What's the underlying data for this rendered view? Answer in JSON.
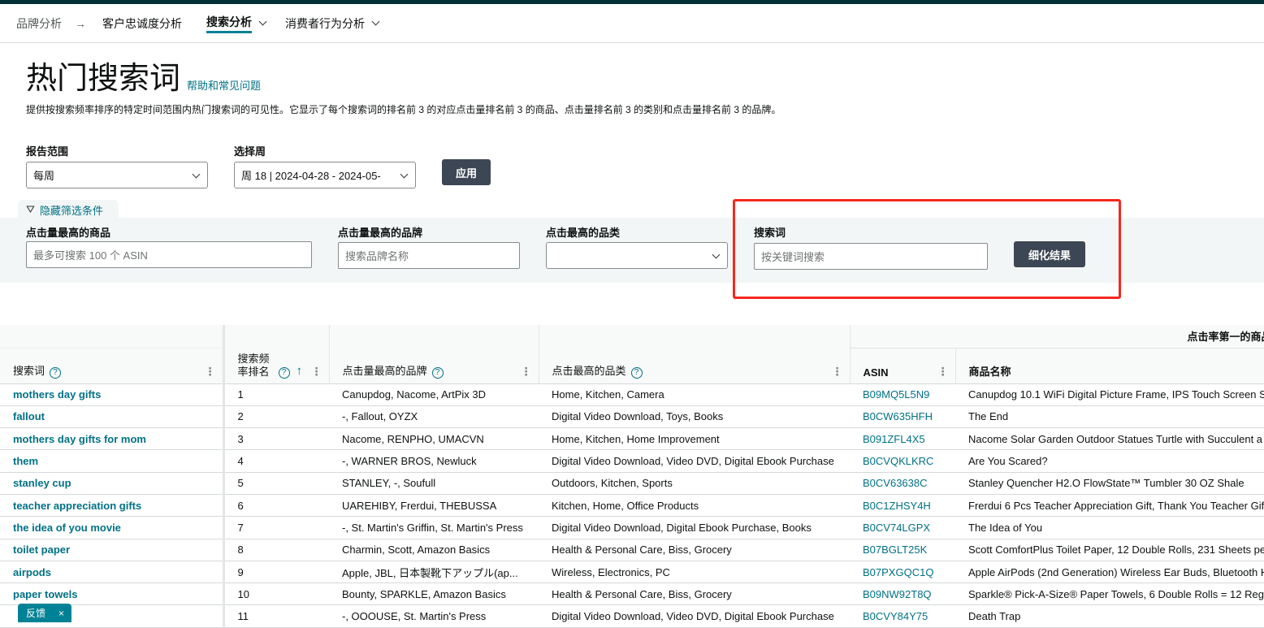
{
  "nav": {
    "items": [
      "品牌分析",
      "客户忠诚度分析",
      "搜索分析",
      "消费者行为分析"
    ]
  },
  "page": {
    "title": "热门搜索词",
    "help_link": "帮助和常见问题",
    "description": "提供按搜索频率排序的特定时间范围内热门搜索词的可见性。它显示了每个搜索词的排名前 3 的对应点击量排名前 3 的商品、点击量排名前 3 的类别和点击量排名前 3 的品牌。"
  },
  "filters": {
    "range_label": "报告范围",
    "range_value": "每周",
    "week_label": "选择周",
    "week_value": "周 18 | 2024-04-28 - 2024-05-",
    "apply": "应用",
    "hide_filters": "隐藏筛选条件",
    "asin_label": "点击量最高的商品",
    "asin_placeholder": "最多可搜索 100 个 ASIN",
    "brand_label": "点击量最高的品牌",
    "brand_placeholder": "搜索品牌名称",
    "category_label": "点击最高的品类",
    "term_label": "搜索词",
    "term_placeholder": "按关键词搜索",
    "refine": "细化结果"
  },
  "table": {
    "group_header": "点击率第一的商品",
    "headers": [
      "搜索词",
      "搜索频率排名",
      "点击量最高的品牌",
      "点击最高的品类",
      "ASIN",
      "商品名称"
    ],
    "rows": [
      [
        "mothers day gifts",
        "1",
        "Canupdog, Nacome, ArtPix 3D",
        "Home, Kitchen, Camera",
        "B09MQ5L5N9",
        "Canupdog 10.1 WiFi Digital Picture Frame, IPS Touch Screen S"
      ],
      [
        "fallout",
        "2",
        "-, Fallout, OYZX",
        "Digital Video Download, Toys, Books",
        "B0CW635HFH",
        "The End"
      ],
      [
        "mothers day gifts for mom",
        "3",
        "Nacome, RENPHO, UMACVN",
        "Home, Kitchen, Home Improvement",
        "B091ZFL4X5",
        "Nacome Solar Garden Outdoor Statues Turtle with Succulent a"
      ],
      [
        "them",
        "4",
        "-, WARNER BROS, Newluck",
        "Digital Video Download, Video DVD, Digital Ebook Purchase",
        "B0CVQKLKRC",
        "Are You Scared?"
      ],
      [
        "stanley cup",
        "5",
        "STANLEY, -, Soufull",
        "Outdoors, Kitchen, Sports",
        "B0CV63638C",
        "Stanley Quencher H2.O FlowState™ Tumbler 30 OZ Shale"
      ],
      [
        "teacher appreciation gifts",
        "6",
        "UAREHIBY, Frerdui, THEBUSSA",
        "Kitchen, Home, Office Products",
        "B0C1ZHSY4H",
        "Frerdui 6 Pcs Teacher Appreciation Gift, Thank You Teacher Gif"
      ],
      [
        "the idea of you movie",
        "7",
        "-, St. Martin's Griffin, St. Martin's Press",
        "Digital Video Download, Digital Ebook Purchase, Books",
        "B0CV74LGPX",
        "The Idea of You"
      ],
      [
        "toilet paper",
        "8",
        "Charmin, Scott, Amazon Basics",
        "Health & Personal Care, Biss, Grocery",
        "B07BGLT25K",
        "Scott ComfortPlus Toilet Paper, 12 Double Rolls, 231 Sheets pe"
      ],
      [
        "airpods",
        "9",
        "Apple, JBL, 日本製靴下アップル(ap...",
        "Wireless, Electronics, PC",
        "B07PXGQC1Q",
        "Apple AirPods (2nd Generation) Wireless Ear Buds, Bluetooth H"
      ],
      [
        "paper towels",
        "10",
        "Bounty, SPARKLE, Amazon Basics",
        "Health & Personal Care, Biss, Grocery",
        "B09NW92T8Q",
        "Sparkle® Pick-A-Size® Paper Towels, 6 Double Rolls = 12 Reg"
      ],
      [
        "",
        "11",
        "-, OOOUSE, St. Martin's Press",
        "Digital Video Download, Video DVD, Digital Ebook Purchase",
        "B0CVY84Y75",
        "Death Trap"
      ]
    ]
  },
  "feedback": {
    "label": "反馈",
    "close": "×"
  },
  "colors": {
    "accent": "#007185",
    "highlight_box": "#f5281e",
    "button": "#3d4654"
  }
}
